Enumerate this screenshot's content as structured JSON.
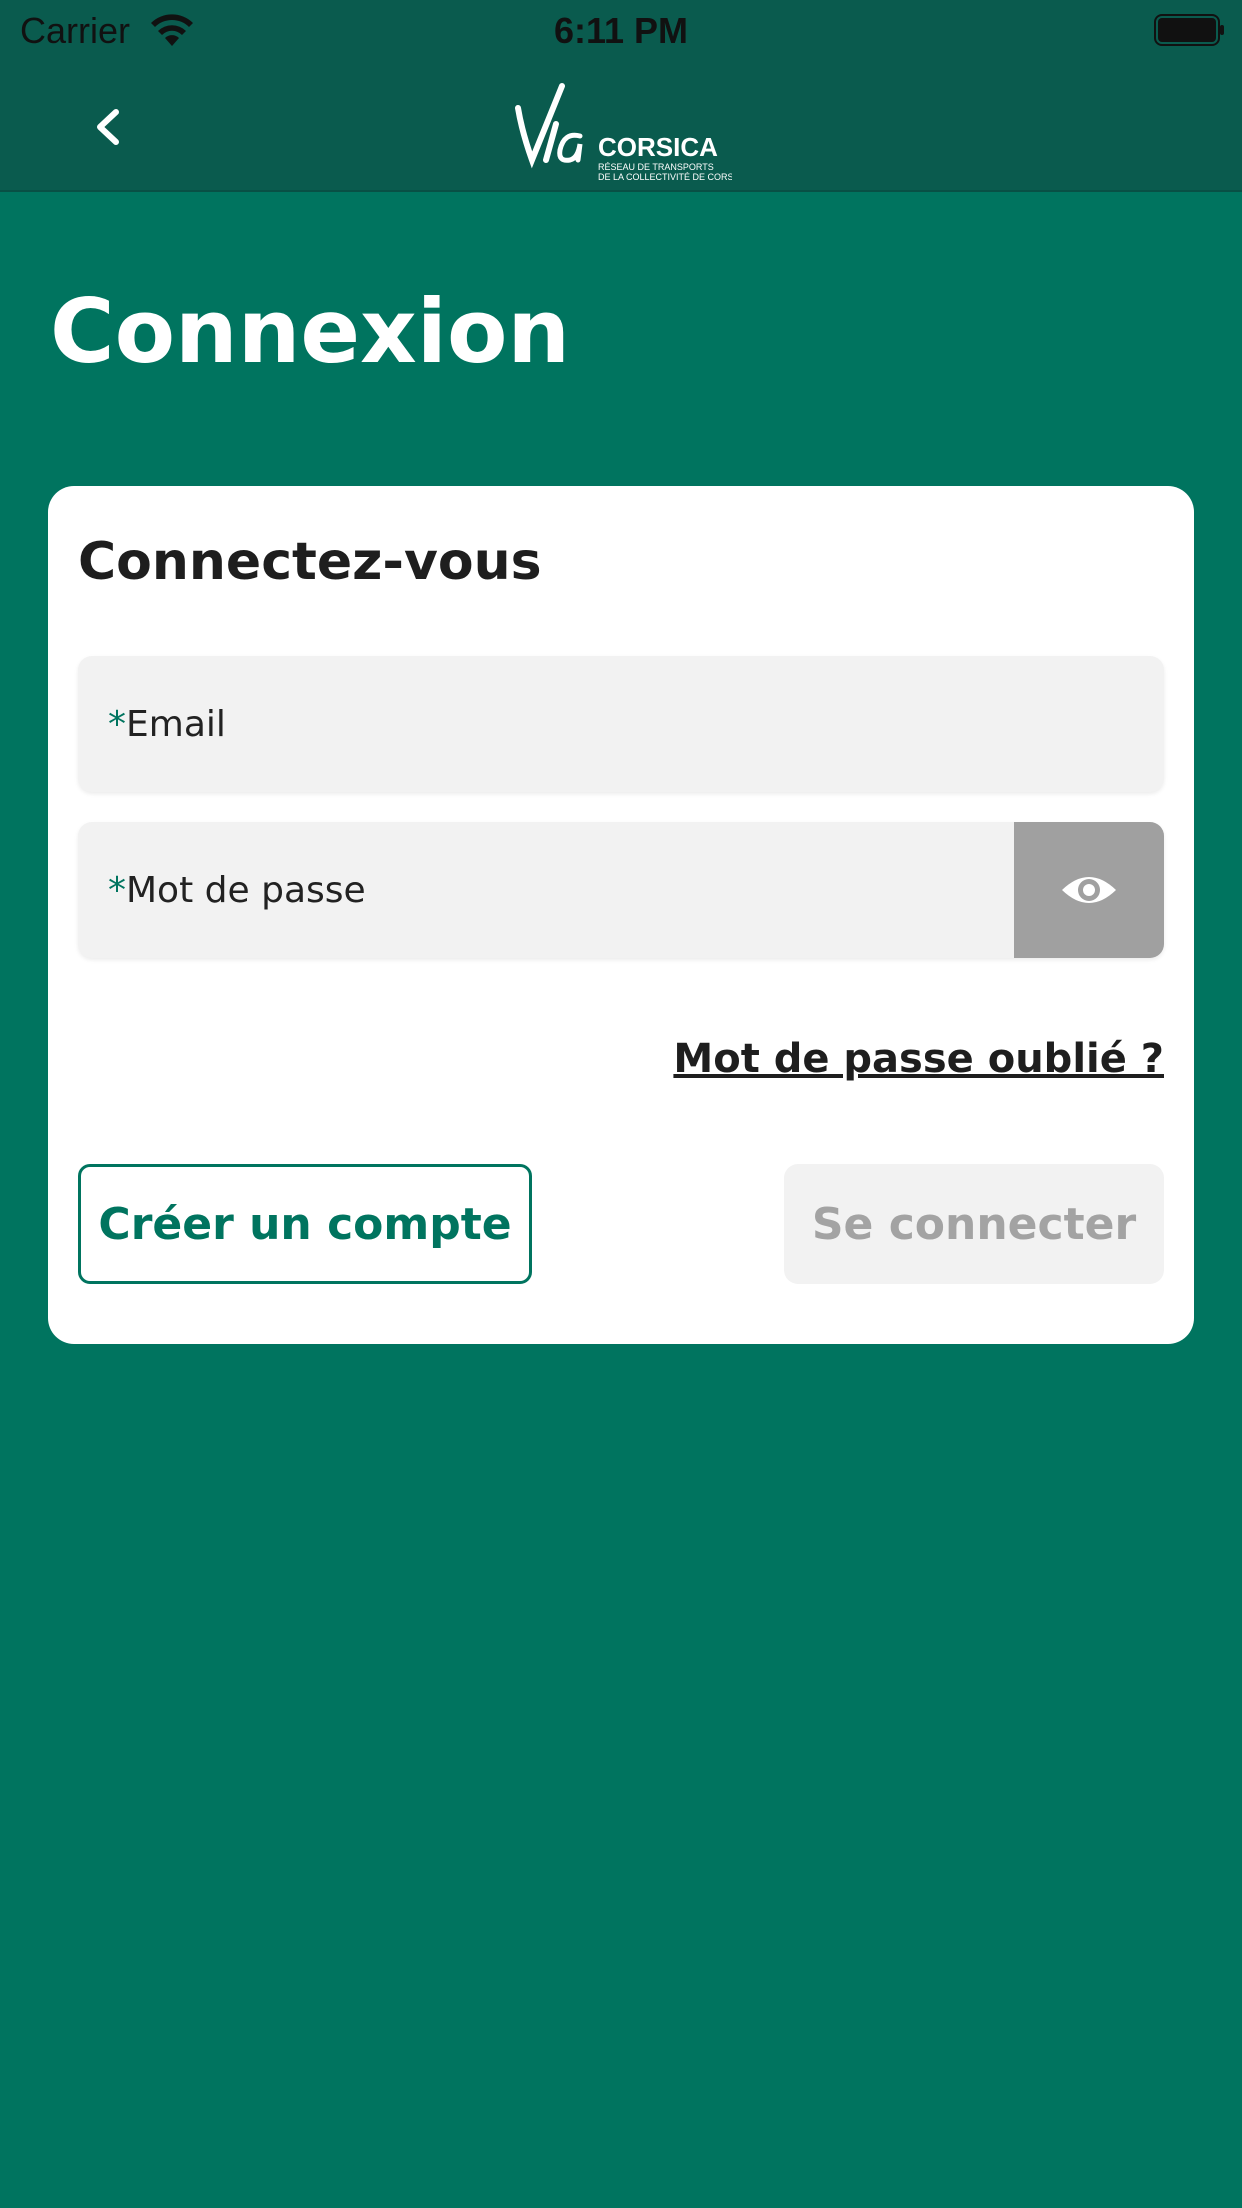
{
  "status_bar": {
    "carrier": "Carrier",
    "time": "6:11 PM"
  },
  "nav": {
    "back_icon": "chevron-left-icon",
    "logo_text": "CORSICA",
    "logo_subtitle_line1": "RÉSEAU DE TRANSPORTS",
    "logo_subtitle_line2": "DE LA COLLECTIVITÉ DE CORSE"
  },
  "page": {
    "title": "Connexion"
  },
  "login_card": {
    "title": "Connectez-vous",
    "email": {
      "required_mark": "*",
      "label": "Email",
      "value": ""
    },
    "password": {
      "required_mark": "*",
      "label": "Mot de passe",
      "value": "",
      "toggle_icon": "eye-icon"
    },
    "forgot_password": "Mot de passe oublié ?",
    "create_account": "Créer un compte",
    "login": "Se connecter"
  },
  "colors": {
    "brand": "#00745f",
    "header": "#0a5b4e",
    "disabled_text": "#a3a3a3",
    "field_bg": "#f2f2f2",
    "eye_button_bg": "#a0a0a0"
  }
}
